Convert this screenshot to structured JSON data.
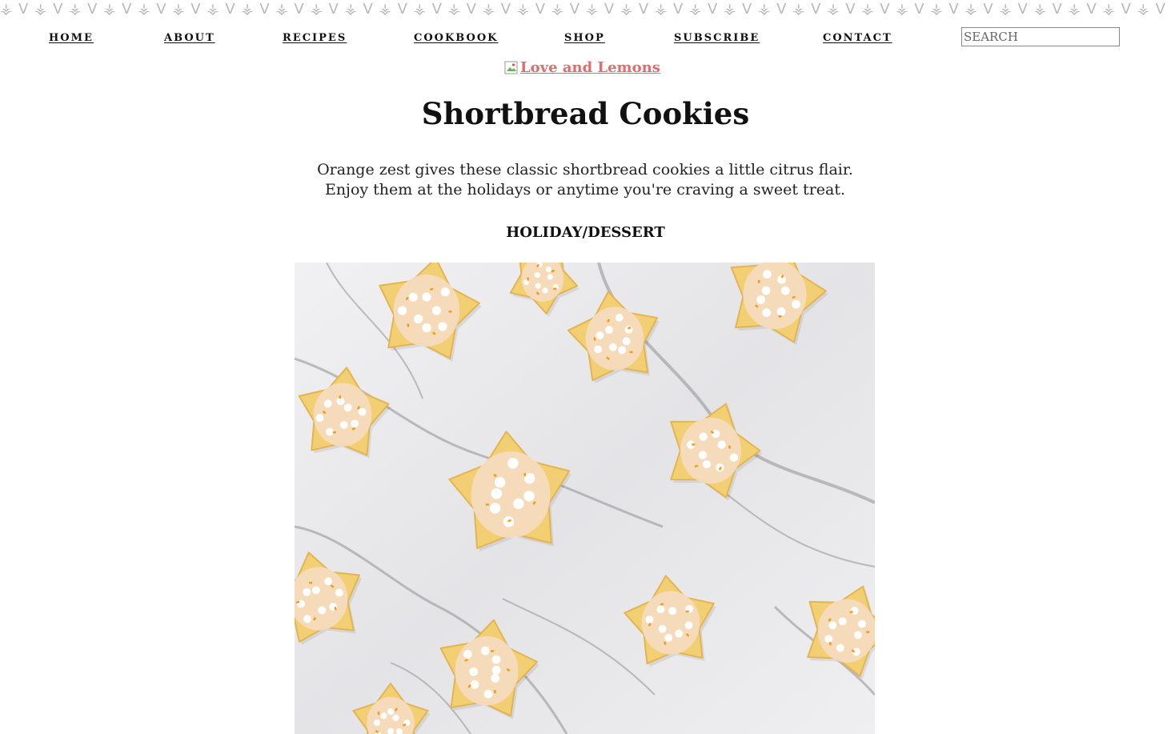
{
  "pattern": {
    "glyph_a": "⚶",
    "glyph_b": "V",
    "color": "#b9b9b9"
  },
  "nav": {
    "items": [
      {
        "label": "HOME"
      },
      {
        "label": "ABOUT"
      },
      {
        "label": "RECIPES"
      },
      {
        "label": "COOKBOOK"
      },
      {
        "label": "SHOP"
      },
      {
        "label": "SUBSCRIBE"
      },
      {
        "label": "CONTACT"
      }
    ]
  },
  "search": {
    "placeholder": "SEARCH",
    "value": ""
  },
  "logo": {
    "alt_text": "Love and Lemons",
    "color": "#e36b6b"
  },
  "post": {
    "title": "Shortbread Cookies",
    "description_line1": "Orange zest gives these classic shortbread cookies a little citrus flair.",
    "description_line2": "Enjoy them at the holidays or anytime you're craving a sweet treat.",
    "category": "HOLIDAY/DESSERT"
  },
  "hero_image": {
    "subject": "iced-star-shortbread-cookies-on-marble",
    "colors": {
      "cookie": "#f2cf72",
      "icing": "#f5dcc0",
      "zest": "#f39c1a",
      "marble": "#e8e8ea"
    }
  }
}
